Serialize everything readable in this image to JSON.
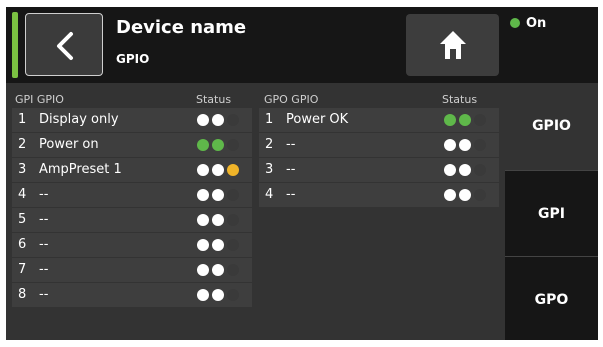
{
  "header": {
    "device_name": "Device name",
    "subtitle": "GPIO",
    "status_label": "On",
    "back_icon": "chevron-left-icon",
    "home_icon": "home-icon"
  },
  "colors": {
    "led_white": "#ffffff",
    "led_off": "#3a3a3a",
    "led_green": "#5fb84a",
    "led_yellow": "#f0b429",
    "status_bar": "#7bc142"
  },
  "gpi_table": {
    "header_name": "GPI GPIO",
    "header_status": "Status",
    "rows": [
      {
        "num": "1",
        "name": "Display only",
        "leds": [
          "white",
          "white",
          "off"
        ]
      },
      {
        "num": "2",
        "name": "Power on",
        "leds": [
          "green",
          "green",
          "off"
        ]
      },
      {
        "num": "3",
        "name": "AmpPreset 1",
        "leds": [
          "white",
          "white",
          "yellow"
        ]
      },
      {
        "num": "4",
        "name": "--",
        "leds": [
          "white",
          "white",
          "off"
        ]
      },
      {
        "num": "5",
        "name": "--",
        "leds": [
          "white",
          "white",
          "off"
        ]
      },
      {
        "num": "6",
        "name": "--",
        "leds": [
          "white",
          "white",
          "off"
        ]
      },
      {
        "num": "7",
        "name": "--",
        "leds": [
          "white",
          "white",
          "off"
        ]
      },
      {
        "num": "8",
        "name": "--",
        "leds": [
          "white",
          "white",
          "off"
        ]
      }
    ]
  },
  "gpo_table": {
    "header_name": "GPO GPIO",
    "header_status": "Status",
    "rows": [
      {
        "num": "1",
        "name": "Power OK",
        "leds": [
          "green",
          "green",
          "off"
        ]
      },
      {
        "num": "2",
        "name": "--",
        "leds": [
          "white",
          "white",
          "off"
        ]
      },
      {
        "num": "3",
        "name": "--",
        "leds": [
          "white",
          "white",
          "off"
        ]
      },
      {
        "num": "4",
        "name": "--",
        "leds": [
          "white",
          "white",
          "off"
        ]
      }
    ]
  },
  "tabs": [
    {
      "label": "GPIO",
      "active": true
    },
    {
      "label": "GPI",
      "active": false
    },
    {
      "label": "GPO",
      "active": false
    }
  ]
}
